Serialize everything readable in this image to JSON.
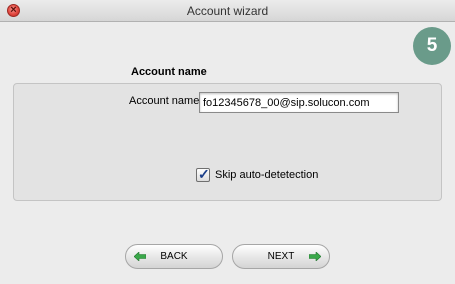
{
  "window": {
    "title": "Account wizard"
  },
  "step": {
    "number": "5"
  },
  "section": {
    "title": "Account name"
  },
  "account": {
    "label": "Account name",
    "value": "fo12345678_00@sip.solucon.com"
  },
  "skip_detection": {
    "label": "Skip auto-detetection",
    "checked": true
  },
  "nav": {
    "back_label": "BACK",
    "next_label": "NEXT"
  },
  "colors": {
    "arrow": "#3aa84a",
    "badge": "#6a9b8a",
    "close": "#e2473f"
  },
  "icons": {
    "close": "close-icon",
    "back": "arrow-left-icon",
    "next": "arrow-right-icon",
    "check": "checkmark-icon"
  }
}
